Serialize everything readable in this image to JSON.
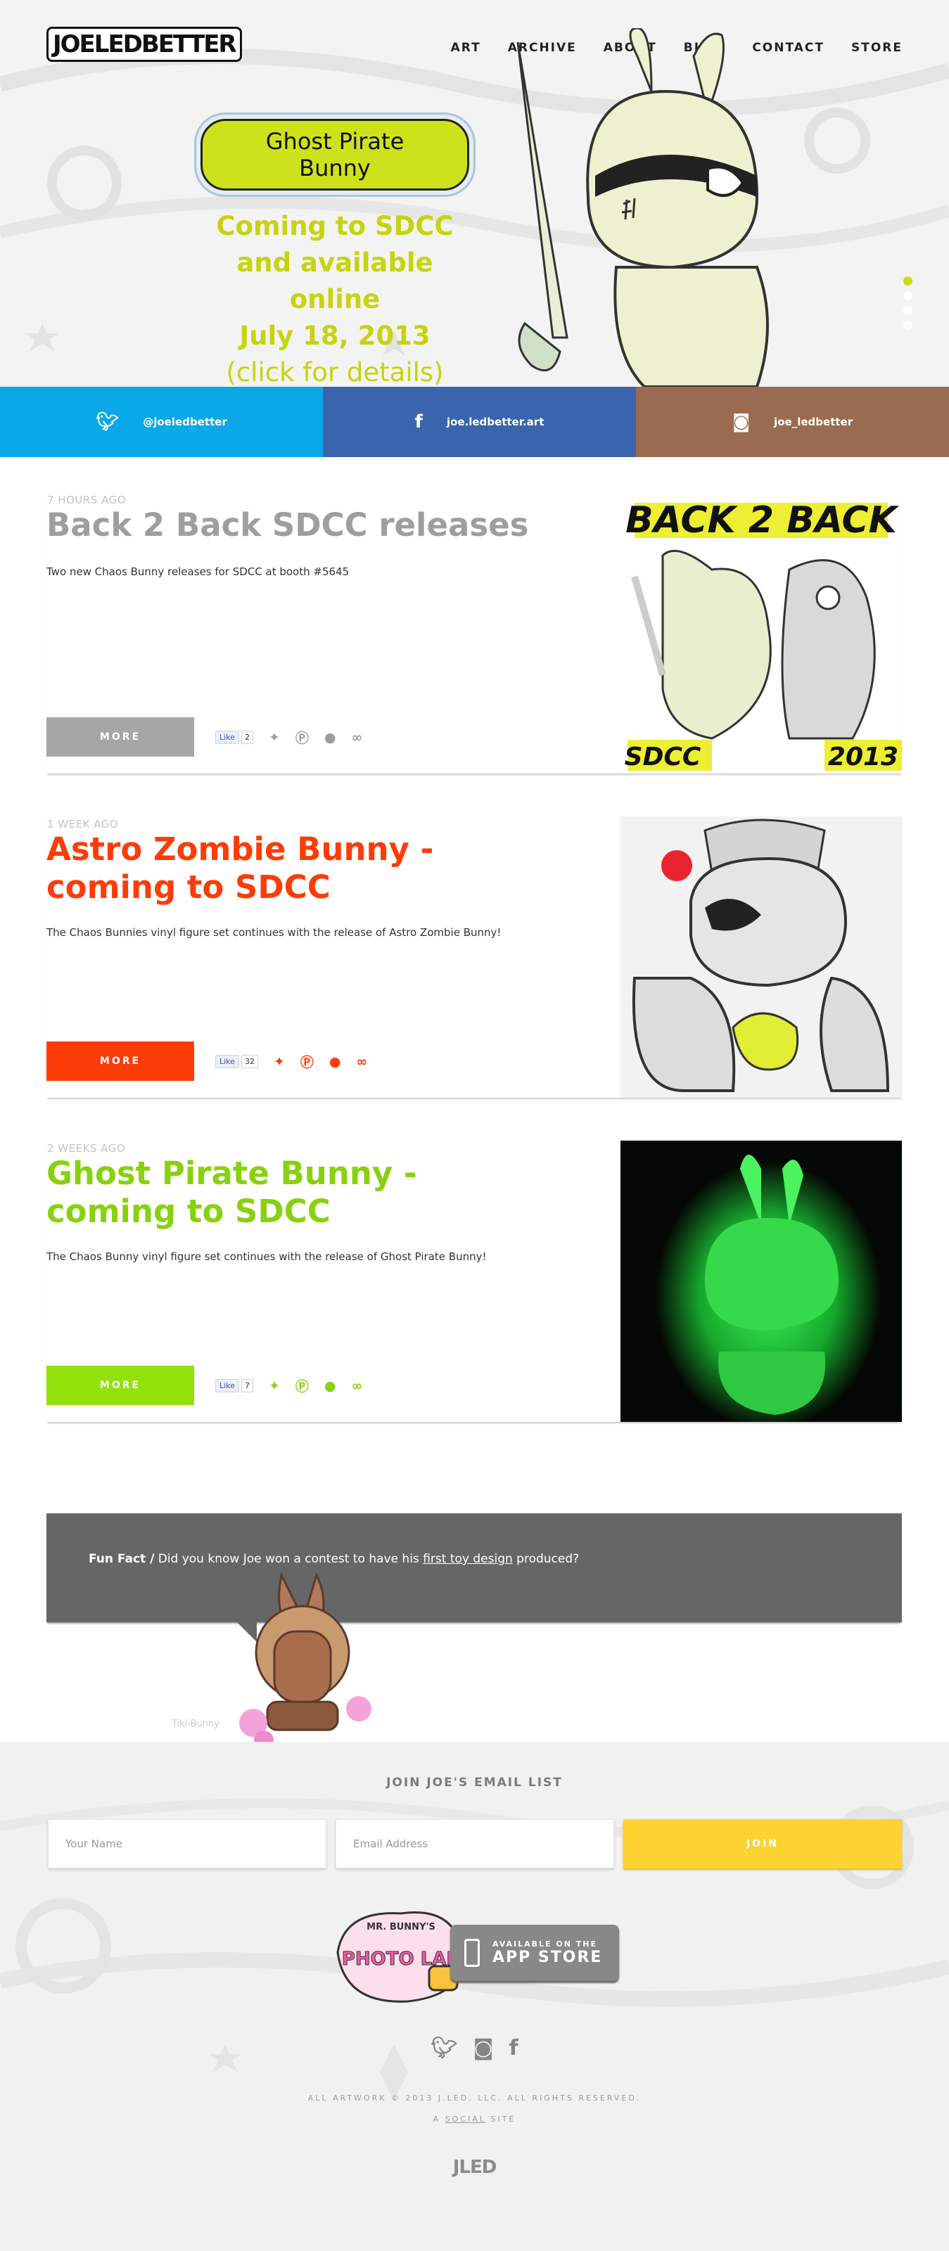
{
  "header": {
    "logo_text": "JOELEDBETTER",
    "nav": [
      "ART",
      "ARCHIVE",
      "ABOUT",
      "BLOG",
      "CONTACT",
      "STORE"
    ]
  },
  "hero": {
    "pill": "Ghost Pirate Bunny",
    "line1": "Coming to SDCC",
    "line2": "and available online",
    "line3": "July 18, 2013",
    "line4": "(click for details)",
    "slides": 4,
    "active_slide": 1
  },
  "social": {
    "twitter": "@joeledbetter",
    "facebook": "joe.ledbetter.art",
    "instagram": "joe_ledbetter"
  },
  "posts": [
    {
      "time": "7 HOURS AGO",
      "title": "Back 2 Back SDCC releases",
      "excerpt": "Two new Chaos Bunny releases for SDCC at booth #5645",
      "more": "MORE",
      "likes": "2",
      "thumb_top": "BACK 2 BACK",
      "thumb_left": "SDCC",
      "thumb_right": "2013"
    },
    {
      "time": "1 WEEK AGO",
      "title": "Astro Zombie Bunny - coming to SDCC",
      "excerpt": "The Chaos Bunnies vinyl figure set continues with the release of Astro Zombie Bunny!",
      "more": "MORE",
      "likes": "32"
    },
    {
      "time": "2 WEEKS AGO",
      "title": "Ghost Pirate Bunny - coming to SDCC",
      "excerpt": "The Chaos Bunny vinyl figure set continues with the release of Ghost Pirate Bunny!",
      "more": "MORE",
      "likes": "7"
    }
  ],
  "share": {
    "like_label": "Like"
  },
  "fun_fact": {
    "label": "Fun Fact /",
    "text_before": " Did you know Joe won a contest to have his ",
    "link": "first toy design",
    "text_after": " produced?",
    "image_label": "Tiki-Bunny"
  },
  "footer": {
    "join_title": "JOIN JOE'S EMAIL LIST",
    "name_placeholder": "Your Name",
    "email_placeholder": "Email Address",
    "join_label": "JOIN",
    "app_top": "MR. BUNNY'S",
    "app_name": "PHOTO LAB",
    "store_line1": "AVAILABLE ON THE",
    "store_line2": "APP STORE",
    "copyright": "ALL ARTWORK © 2013 J.LED, LLC. ALL RIGHTS RESERVED.",
    "social_site_a": "A ",
    "social_site_link": "SOCIAL",
    "social_site_b": " SITE",
    "footer_logo": "JLED"
  },
  "colors": {
    "twitter": "#0aa8e7",
    "facebook": "#3a64ac",
    "instagram": "#9b6b51",
    "post1": "#9e9e9e",
    "post2": "#fe3c08",
    "post3": "#88d110",
    "hero_accent": "#c6d40d",
    "join": "#fdd332"
  },
  "icons": [
    "twitter-icon",
    "facebook-icon",
    "pinterest-icon",
    "comment-icon",
    "link-icon",
    "instagram-icon",
    "phone-icon"
  ]
}
